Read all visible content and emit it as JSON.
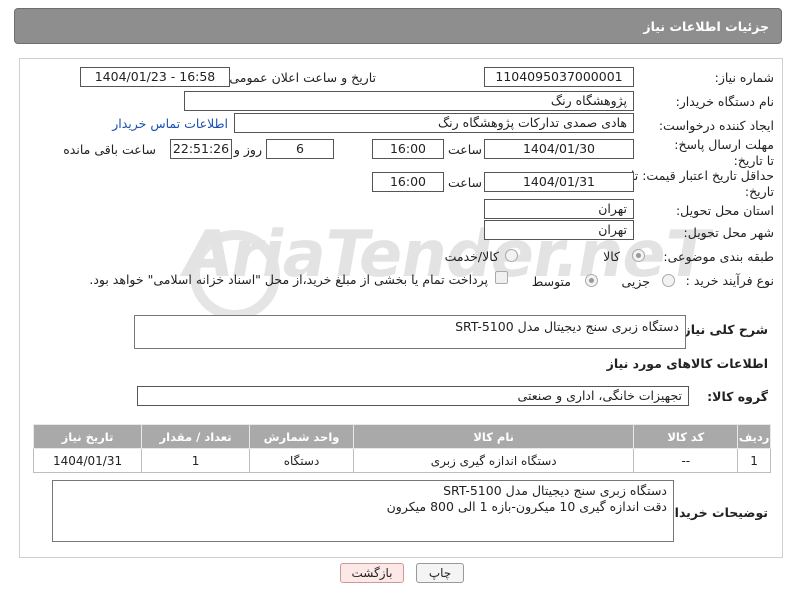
{
  "header": {
    "title": "جزئیات اطلاعات نیاز"
  },
  "fields": {
    "need_number_label": "شماره نیاز:",
    "need_number": "1104095037000001",
    "announce_label": "تاریخ و ساعت اعلان عمومی:",
    "announce_value": "1404/01/23 - 16:58",
    "buyer_org_label": "نام دستگاه خریدار:",
    "buyer_org": "پژوهشگاه رنگ",
    "creator_label": "ایجاد کننده درخواست:",
    "creator": "هادی صمدی تدارکات پژوهشگاه رنگ",
    "contact_link": "اطلاعات تماس خریدار",
    "deadline_label": "مهلت ارسال پاسخ: تا تاریخ:",
    "deadline_date": "1404/01/30",
    "time_label": "ساعت",
    "deadline_time": "16:00",
    "days_value": "6",
    "days_label": "روز و",
    "remaining_time": "22:51:26",
    "remaining_label": "ساعت باقی مانده",
    "validity_label": "حداقل تاریخ اعتبار قیمت: تا تاریخ:",
    "validity_date": "1404/01/31",
    "validity_time": "16:00",
    "province_label": "استان محل تحویل:",
    "province": "تهران",
    "city_label": "شهر محل تحویل:",
    "city": "تهران",
    "category_label": "طبقه بندی موضوعی:",
    "category_goods": "کالا",
    "category_goods_service": "کالا/خدمت",
    "process_label": "نوع فرآیند خرید :",
    "process_minor": "جزیی",
    "process_medium": "متوسط",
    "payment_note": "پرداخت تمام یا بخشی از مبلغ خرید،از محل \"اسناد خزانه اسلامی\" خواهد بود.",
    "description_label": "شرح کلی نیاز:",
    "description": "دستگاه زبری سنج دیجیتال مدل SRT-5100",
    "goods_info_title": "اطلاعات کالاهای مورد نیاز",
    "goods_group_label": "گروه کالا:",
    "goods_group": "تجهیزات خانگی، اداری و صنعتی",
    "buyer_notes_label": "توضیحات خریدار:",
    "buyer_notes_line1": "دستگاه زبری سنج دیجیتال مدل SRT-5100",
    "buyer_notes_line2": "دقت اندازه گیری 10 میکرون-بازه 1 الی 800 میکرون"
  },
  "table": {
    "headers": [
      "ردیف",
      "کد کالا",
      "نام کالا",
      "واحد شمارش",
      "تعداد / مقدار",
      "تاریخ نیاز"
    ],
    "rows": [
      [
        "1",
        "--",
        "دستگاه اندازه گیری زبری",
        "دستگاه",
        "1",
        "1404/01/31"
      ]
    ]
  },
  "buttons": {
    "print": "چاپ",
    "back": "بازگشت"
  },
  "watermark": "AriaTender.neT",
  "colors": {
    "header_bg": "#8e8e8e",
    "table_header_bg": "#a9a9a9",
    "link": "#1a4fb3"
  }
}
